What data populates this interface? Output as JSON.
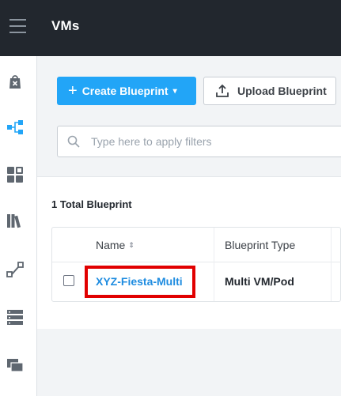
{
  "header": {
    "title": "VMs"
  },
  "toolbar": {
    "create_label": "Create Blueprint",
    "upload_label": "Upload Blueprint"
  },
  "filter": {
    "placeholder": "Type here to apply filters"
  },
  "summary": {
    "total": "1 Total Blueprint"
  },
  "table": {
    "columns": [
      "Name",
      "Blueprint Type"
    ],
    "rows": [
      {
        "name": "XYZ-Fiesta-Multi",
        "type": "Multi VM/Pod"
      }
    ]
  },
  "colors": {
    "topbar": "#22272e",
    "accent": "#22a5f7",
    "link": "#1f8ce0",
    "highlight": "#e10000"
  }
}
